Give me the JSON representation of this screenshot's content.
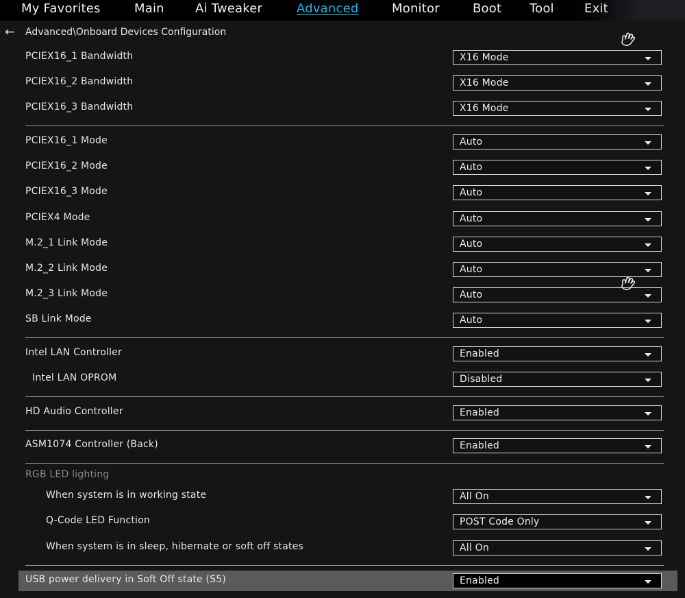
{
  "tabs": [
    "My Favorites",
    "Main",
    "Ai Tweaker",
    "Advanced",
    "Monitor",
    "Boot",
    "Tool",
    "Exit"
  ],
  "active_tab": "Advanced",
  "breadcrumb": "Advanced\\Onboard Devices Configuration",
  "settings": [
    {
      "label": "PCIEX16_1 Bandwidth",
      "value": "X16 Mode"
    },
    {
      "label": "PCIEX16_2 Bandwidth",
      "value": "X16 Mode"
    },
    {
      "label": "PCIEX16_3 Bandwidth",
      "value": "X16 Mode"
    },
    {
      "label": "PCIEX16_1 Mode",
      "value": "Auto"
    },
    {
      "label": "PCIEX16_2 Mode",
      "value": "Auto"
    },
    {
      "label": "PCIEX16_3 Mode",
      "value": "Auto"
    },
    {
      "label": "PCIEX4 Mode",
      "value": "Auto"
    },
    {
      "label": "M.2_1 Link Mode",
      "value": "Auto"
    },
    {
      "label": "M.2_2 Link Mode",
      "value": "Auto"
    },
    {
      "label": "M.2_3 Link Mode",
      "value": "Auto"
    },
    {
      "label": "SB Link Mode",
      "value": "Auto"
    },
    {
      "label": "Intel LAN Controller",
      "value": "Enabled"
    },
    {
      "label": "Intel LAN OPROM",
      "value": "Disabled"
    },
    {
      "label": "HD Audio Controller",
      "value": "Enabled"
    },
    {
      "label": "ASM1074 Controller (Back)",
      "value": "Enabled"
    },
    {
      "label": "When system is in working state",
      "value": "All On"
    },
    {
      "label": "Q-Code LED Function",
      "value": "POST Code Only"
    },
    {
      "label": "When system is in sleep, hibernate or soft off states",
      "value": "All On"
    },
    {
      "label": "USB power delivery in Soft Off state (S5)",
      "value": "Enabled"
    }
  ],
  "rgb_section_title": "RGB LED lighting",
  "selected_item": "USB power delivery in Soft Off state (S5)",
  "colors": {
    "accent": "#19b6e6",
    "background": "#151515",
    "highlight": "#5a5a5a"
  },
  "icons": [
    "back-arrow-icon",
    "hand-cursor-icon",
    "dropdown-caret-icon"
  ]
}
